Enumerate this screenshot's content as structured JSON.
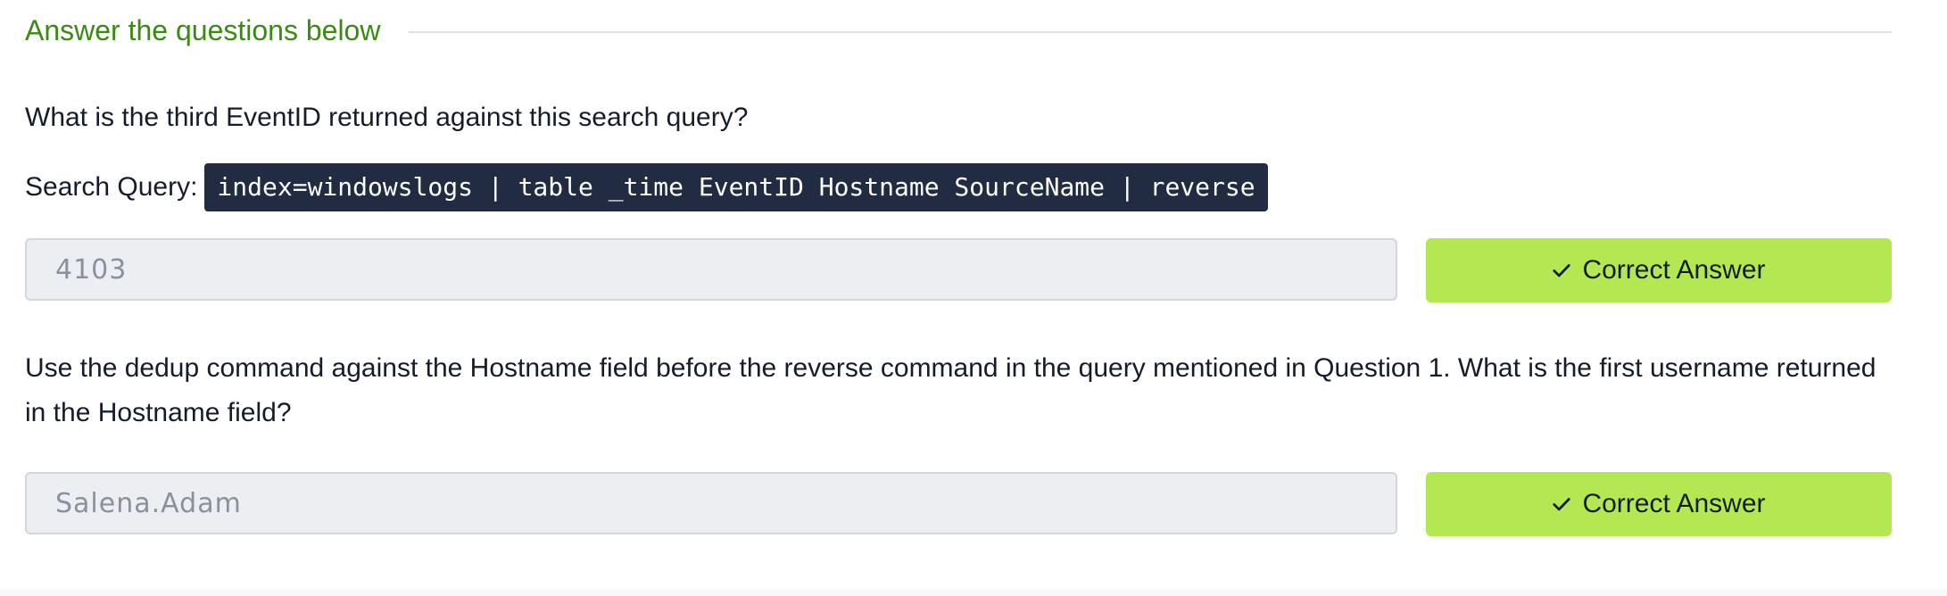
{
  "section": {
    "title": "Answer the questions below"
  },
  "question1": {
    "text": "What is the third EventID returned against this search query?",
    "search_label": "Search Query:",
    "query_code": "index=windowslogs | table _time EventID Hostname SourceName | reverse",
    "answer_placeholder": "4103",
    "button_label": "Correct Answer",
    "button_icon": "check-icon"
  },
  "question2": {
    "text": "Use the dedup command against the Hostname field before the reverse command in the query mentioned in Question 1. What is the first username returned in the Hostname field?",
    "answer_placeholder": "Salena.Adam",
    "button_label": "Correct Answer",
    "button_icon": "check-icon"
  },
  "colors": {
    "title_green": "#3b8a14",
    "button_green": "#b3e853",
    "code_bg": "#212c42",
    "field_bg": "#eceef2"
  }
}
